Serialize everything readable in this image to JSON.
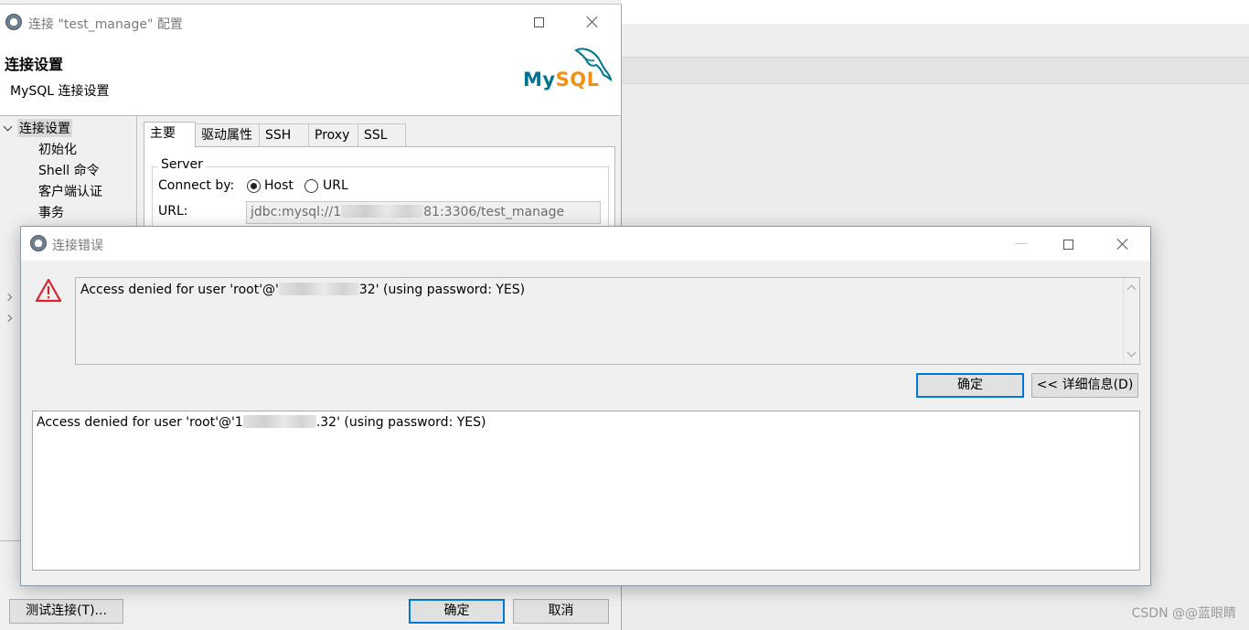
{
  "background": {
    "watermark": "CSDN @@蓝眼睛"
  },
  "config_dialog": {
    "title": "连接 \"test_manage\" 配置",
    "header": {
      "title": "连接设置",
      "subtitle": "MySQL 连接设置",
      "logo": {
        "text_my": "My",
        "text_sql": "SQL",
        "colors": {
          "my": "#00758f",
          "sql": "#f29111"
        }
      }
    },
    "tree": {
      "root": "连接设置",
      "children": [
        "初始化",
        "Shell 命令",
        "客户端认证",
        "事务"
      ]
    },
    "tabs": [
      "主要",
      "驱动属性",
      "SSH",
      "Proxy",
      "SSL"
    ],
    "active_tab": "主要",
    "server": {
      "group_title": "Server",
      "connect_by_label": "Connect by:",
      "options": [
        "Host",
        "URL"
      ],
      "selected_option": "Host",
      "url_label": "URL:",
      "url_prefix": "jdbc:mysql://1",
      "url_suffix": "81:3306/test_manage"
    },
    "buttons": {
      "test": "测试连接(T)...",
      "ok": "确定",
      "cancel": "取消"
    }
  },
  "error_dialog": {
    "title": "连接错误",
    "message_prefix": "Access denied for user 'root'@'",
    "message_suffix": "32' (using password: YES)",
    "detail_prefix": "Access denied for user 'root'@'1",
    "detail_suffix": ".32' (using password: YES)",
    "buttons": {
      "ok": "确定",
      "details": "<< 详细信息(D)"
    },
    "accent_color": "#0078d7",
    "warning_color": "#d9232f"
  }
}
